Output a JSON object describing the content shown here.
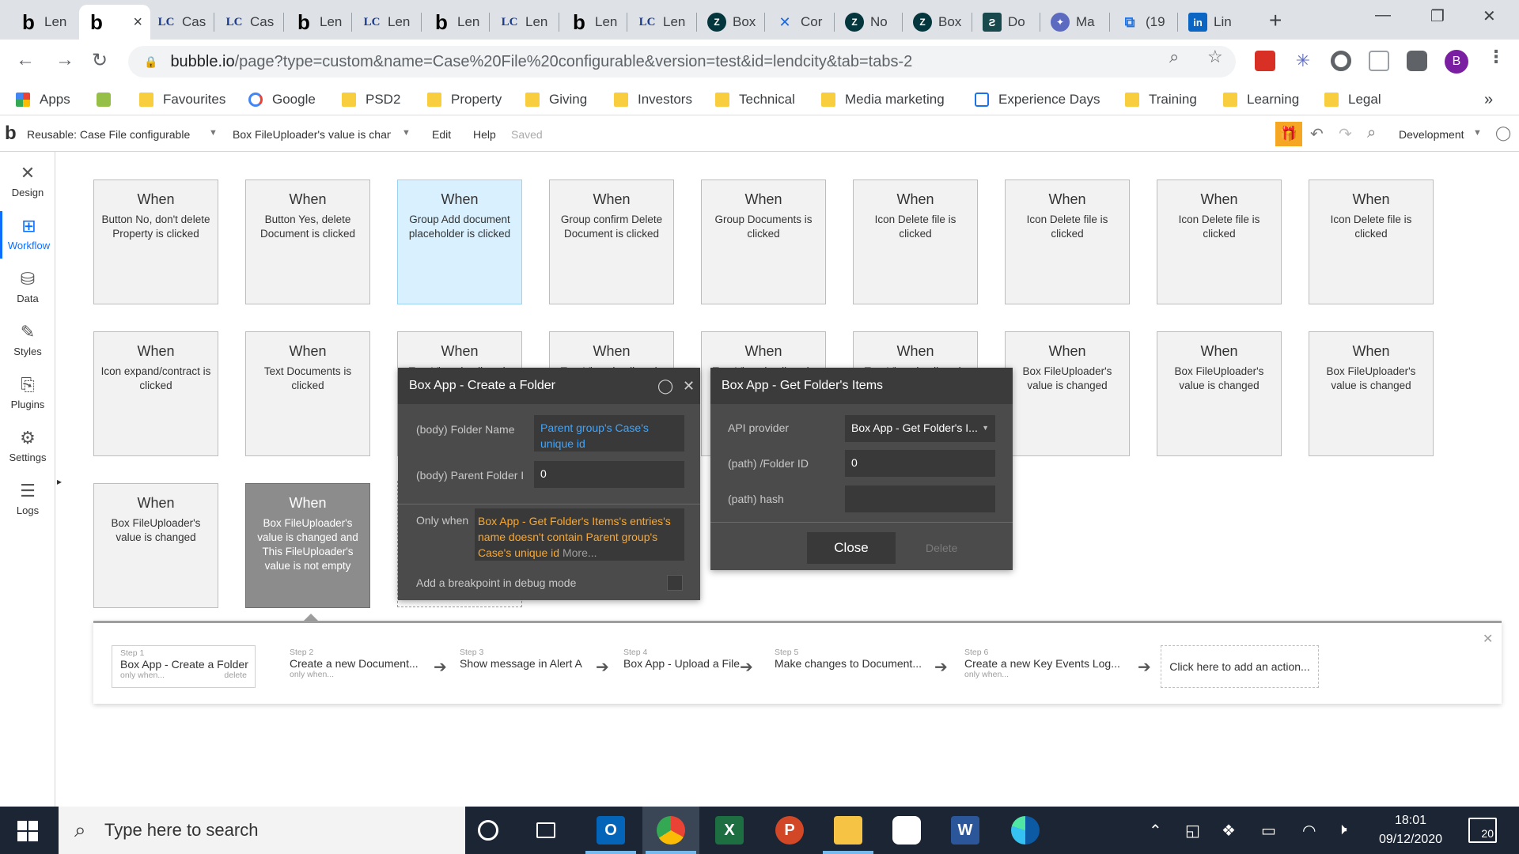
{
  "browser": {
    "tabs": [
      {
        "icon": "bubble-icon",
        "label": "Len",
        "active": false
      },
      {
        "icon": "bubble-icon",
        "label": "",
        "active": true
      },
      {
        "icon": "lc-icon",
        "label": "Cas",
        "active": false
      },
      {
        "icon": "lc-icon",
        "label": "Cas",
        "active": false
      },
      {
        "icon": "bubble-icon",
        "label": "Len",
        "active": false
      },
      {
        "icon": "lc-icon",
        "label": "Len",
        "active": false
      },
      {
        "icon": "bubble-icon",
        "label": "Len",
        "active": false
      },
      {
        "icon": "lc-icon",
        "label": "Len",
        "active": false
      },
      {
        "icon": "bubble-icon",
        "label": "Len",
        "active": false
      },
      {
        "icon": "lc-icon",
        "label": "Len",
        "active": false
      },
      {
        "icon": "zendesk-icon",
        "label": "Box",
        "active": false
      },
      {
        "icon": "confluence-icon",
        "label": "Cor",
        "active": false
      },
      {
        "icon": "zendesk-icon",
        "label": "No",
        "active": false
      },
      {
        "icon": "zendesk-icon",
        "label": "Box",
        "active": false
      },
      {
        "icon": "docs-icon",
        "label": "Do",
        "active": false
      },
      {
        "icon": "mail-icon",
        "label": "Ma",
        "active": false
      },
      {
        "icon": "teams-icon",
        "label": "(19",
        "active": false
      },
      {
        "icon": "linkedin-icon",
        "label": "Lin",
        "active": false
      }
    ],
    "tab_glyphs": {
      "bubble": "b",
      "lc": "LC",
      "zendesk": "Z",
      "confluence": "✕",
      "docs": "Ƨ",
      "mail": "✦",
      "teams": "⧉",
      "linkedin": "in"
    },
    "tab_close": "×",
    "new_tab": "+",
    "window_controls": {
      "minimize": "—",
      "restore": "❐",
      "close": "✕"
    },
    "nav": {
      "back": "←",
      "forward": "→",
      "reload": "↻",
      "lock": "🔒"
    },
    "url_host": "bubble.io",
    "url_path": "/page?type=custom&name=Case%20File%20configurable&version=test&id=lendcity&tab=tabs-2",
    "omni_icons": {
      "zoom": "⌕",
      "star": "☆"
    },
    "extensions": [
      "calendar-ext",
      "snowflake-ext",
      "circle-ext",
      "clipper-ext",
      "puzzle-ext"
    ],
    "profile": "B",
    "menu": "⋮",
    "bookmarks": [
      {
        "label": "Apps",
        "icon": "apps-icon"
      },
      {
        "label": "",
        "icon": "shopify-icon"
      },
      {
        "label": "Favourites",
        "icon": "folder-icon"
      },
      {
        "label": "Google",
        "icon": "google-icon"
      },
      {
        "label": "PSD2",
        "icon": "folder-icon"
      },
      {
        "label": "Property",
        "icon": "folder-icon"
      },
      {
        "label": "Giving",
        "icon": "folder-icon"
      },
      {
        "label": "Investors",
        "icon": "folder-icon"
      },
      {
        "label": "Technical",
        "icon": "folder-icon"
      },
      {
        "label": "Media marketing",
        "icon": "folder-icon"
      },
      {
        "label": "Experience Days",
        "icon": "experience-icon"
      },
      {
        "label": "Training",
        "icon": "folder-icon"
      },
      {
        "label": "Learning",
        "icon": "folder-icon"
      },
      {
        "label": "Legal",
        "icon": "folder-icon"
      }
    ],
    "bookmarks_more": "»"
  },
  "editor": {
    "logo": "b",
    "page_select": "Reusable: Case File configurable",
    "event_select": "Box FileUploader's value is chan...",
    "menu_edit": "Edit",
    "menu_help": "Help",
    "saved_status": "Saved",
    "version": "Development",
    "gift_icon": "🎁",
    "undo": "↶",
    "redo": "↷",
    "search": "⌕",
    "account": "◯"
  },
  "sidebar": [
    {
      "label": "Design",
      "icon": "design-icon",
      "glyph": "✕",
      "active": false
    },
    {
      "label": "Workflow",
      "icon": "workflow-icon",
      "glyph": "⊞",
      "active": true
    },
    {
      "label": "Data",
      "icon": "database-icon",
      "glyph": "⛁",
      "active": false
    },
    {
      "label": "Styles",
      "icon": "brush-icon",
      "glyph": "✎",
      "active": false
    },
    {
      "label": "Plugins",
      "icon": "plugin-icon",
      "glyph": "⎘",
      "active": false
    },
    {
      "label": "Settings",
      "icon": "gear-icon",
      "glyph": "⚙",
      "active": false
    },
    {
      "label": "Logs",
      "icon": "logs-icon",
      "glyph": "☰",
      "active": false
    }
  ],
  "sidebar_toggle": "▸",
  "cards": [
    {
      "when": "When",
      "desc": "Button No, don't delete Property is clicked",
      "state": ""
    },
    {
      "when": "When",
      "desc": "Button Yes, delete Document is clicked",
      "state": ""
    },
    {
      "when": "When",
      "desc": "Group Add document placeholder is clicked",
      "state": "selected"
    },
    {
      "when": "When",
      "desc": "Group confirm Delete Document is clicked",
      "state": ""
    },
    {
      "when": "When",
      "desc": "Group Documents is clicked",
      "state": ""
    },
    {
      "when": "When",
      "desc": "Icon Delete file is clicked",
      "state": ""
    },
    {
      "when": "When",
      "desc": "Icon Delete file is clicked",
      "state": ""
    },
    {
      "when": "When",
      "desc": "Icon Delete file is clicked",
      "state": ""
    },
    {
      "when": "When",
      "desc": "Icon Delete file is clicked",
      "state": ""
    },
    {
      "when": "When",
      "desc": "Icon expand/contract is clicked",
      "state": ""
    },
    {
      "when": "When",
      "desc": "Text Documents is clicked",
      "state": ""
    },
    {
      "when": "When",
      "desc": "Text View details ... is",
      "state": ""
    },
    {
      "when": "When",
      "desc": "Text View details ... is",
      "state": ""
    },
    {
      "when": "When",
      "desc": "Text View details ... is",
      "state": ""
    },
    {
      "when": "When",
      "desc": "Text View details ... is",
      "state": ""
    },
    {
      "when": "When",
      "desc": "Box FileUploader's value is changed",
      "state": ""
    },
    {
      "when": "When",
      "desc": "Box FileUploader's value is changed",
      "state": ""
    },
    {
      "when": "When",
      "desc": "Box FileUploader's value is changed",
      "state": ""
    },
    {
      "when": "When",
      "desc": "Box FileUploader's value is changed",
      "state": ""
    },
    {
      "when": "When",
      "desc": "Box FileUploader's value is changed and This FileUploader's value is not empty",
      "state": "dark"
    }
  ],
  "create_folder_panel": {
    "title": "Box App - Create a Folder",
    "comment_icon": "◯",
    "close_icon": "✕",
    "folder_name_label": "(body) Folder Name",
    "folder_name_value": "Parent group's Case's unique id",
    "parent_folder_label": "(body) Parent Folder I",
    "parent_folder_value": "0",
    "only_when_label": "Only when",
    "only_when_value": "Box App - Get Folder's Items's entries's name doesn't contain Parent group's Case's unique id",
    "only_when_more": "More...",
    "breakpoint_label": "Add a breakpoint in debug mode"
  },
  "get_items_panel": {
    "title": "Box App - Get Folder's Items",
    "api_provider_label": "API provider",
    "api_provider_value": "Box App - Get Folder's I...",
    "folder_id_label": "(path) /Folder ID",
    "folder_id_value": "0",
    "hash_label": "(path) hash",
    "hash_value": "",
    "close_label": "Close",
    "delete_label": "Delete"
  },
  "steps": [
    {
      "num": "Step 1",
      "title": "Box App - Create a Folder",
      "sub": "only when...",
      "action": "delete"
    },
    {
      "num": "Step 2",
      "title": "Create a new Document...",
      "sub": "only when...",
      "action": ""
    },
    {
      "num": "Step 3",
      "title": "Show message in Alert A",
      "sub": "",
      "action": ""
    },
    {
      "num": "Step 4",
      "title": "Box App - Upload a File",
      "sub": "",
      "action": ""
    },
    {
      "num": "Step 5",
      "title": "Make changes to Document...",
      "sub": "",
      "action": ""
    },
    {
      "num": "Step 6",
      "title": "Create a new Key Events Log...",
      "sub": "only when...",
      "action": ""
    }
  ],
  "add_action": "Click here to add an action...",
  "steps_close": "✕",
  "step_arrow": "➔",
  "taskbar": {
    "search_placeholder": "Type here to search",
    "search_icon": "⌕",
    "apps": [
      "cortana-icon",
      "task-view-icon",
      "outlook-icon",
      "chrome-icon",
      "excel-icon",
      "powerpoint-icon",
      "explorer-icon",
      "slack-icon",
      "word-icon",
      "edge-icon"
    ],
    "tray": {
      "up": "⌃",
      "meet": "◱",
      "dropbox": "❖",
      "battery": "▭",
      "wifi": "◠",
      "volume": "🕨"
    },
    "time": "18:01",
    "date": "09/12/2020",
    "notifications": "20"
  },
  "colors": {
    "bubble_blue": "#0d6efd",
    "selected_card": "#d9f1ff",
    "dark_card": "#8c8c8c",
    "panel_bg": "#4b4b4b",
    "condition_orange": "#ffa726",
    "dynamic_blue": "#3ea6ff",
    "taskbar": "#1c2533"
  }
}
